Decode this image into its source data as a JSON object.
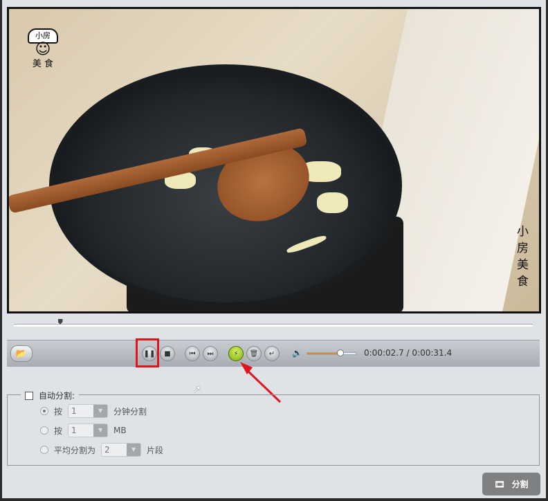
{
  "video": {
    "logo_text": "小房 美食",
    "logo_top": "小房",
    "logo_bottom": "美 食",
    "watermark_vertical": "小房美食"
  },
  "player": {
    "time_current": "0:00:02.7",
    "time_separator": "/",
    "time_total": "0:00:31.4",
    "seek_progress": 0.086,
    "volume_level": 0.68
  },
  "split_settings": {
    "auto_split_label": "自动分割:",
    "auto_split_checked": false,
    "options": [
      {
        "prefix": "按",
        "value": "1",
        "suffix": "分钟分割",
        "selected": true
      },
      {
        "prefix": "按",
        "value": "1",
        "suffix": "MB",
        "selected": false
      },
      {
        "prefix": "平均分割为",
        "value": "2",
        "suffix": "片段",
        "selected": false
      }
    ]
  },
  "split_button": {
    "label": "分割"
  },
  "colors": {
    "highlight": "#e0141b",
    "accent_green": "#9ccf1c",
    "volume_fill": "#d9893e"
  }
}
